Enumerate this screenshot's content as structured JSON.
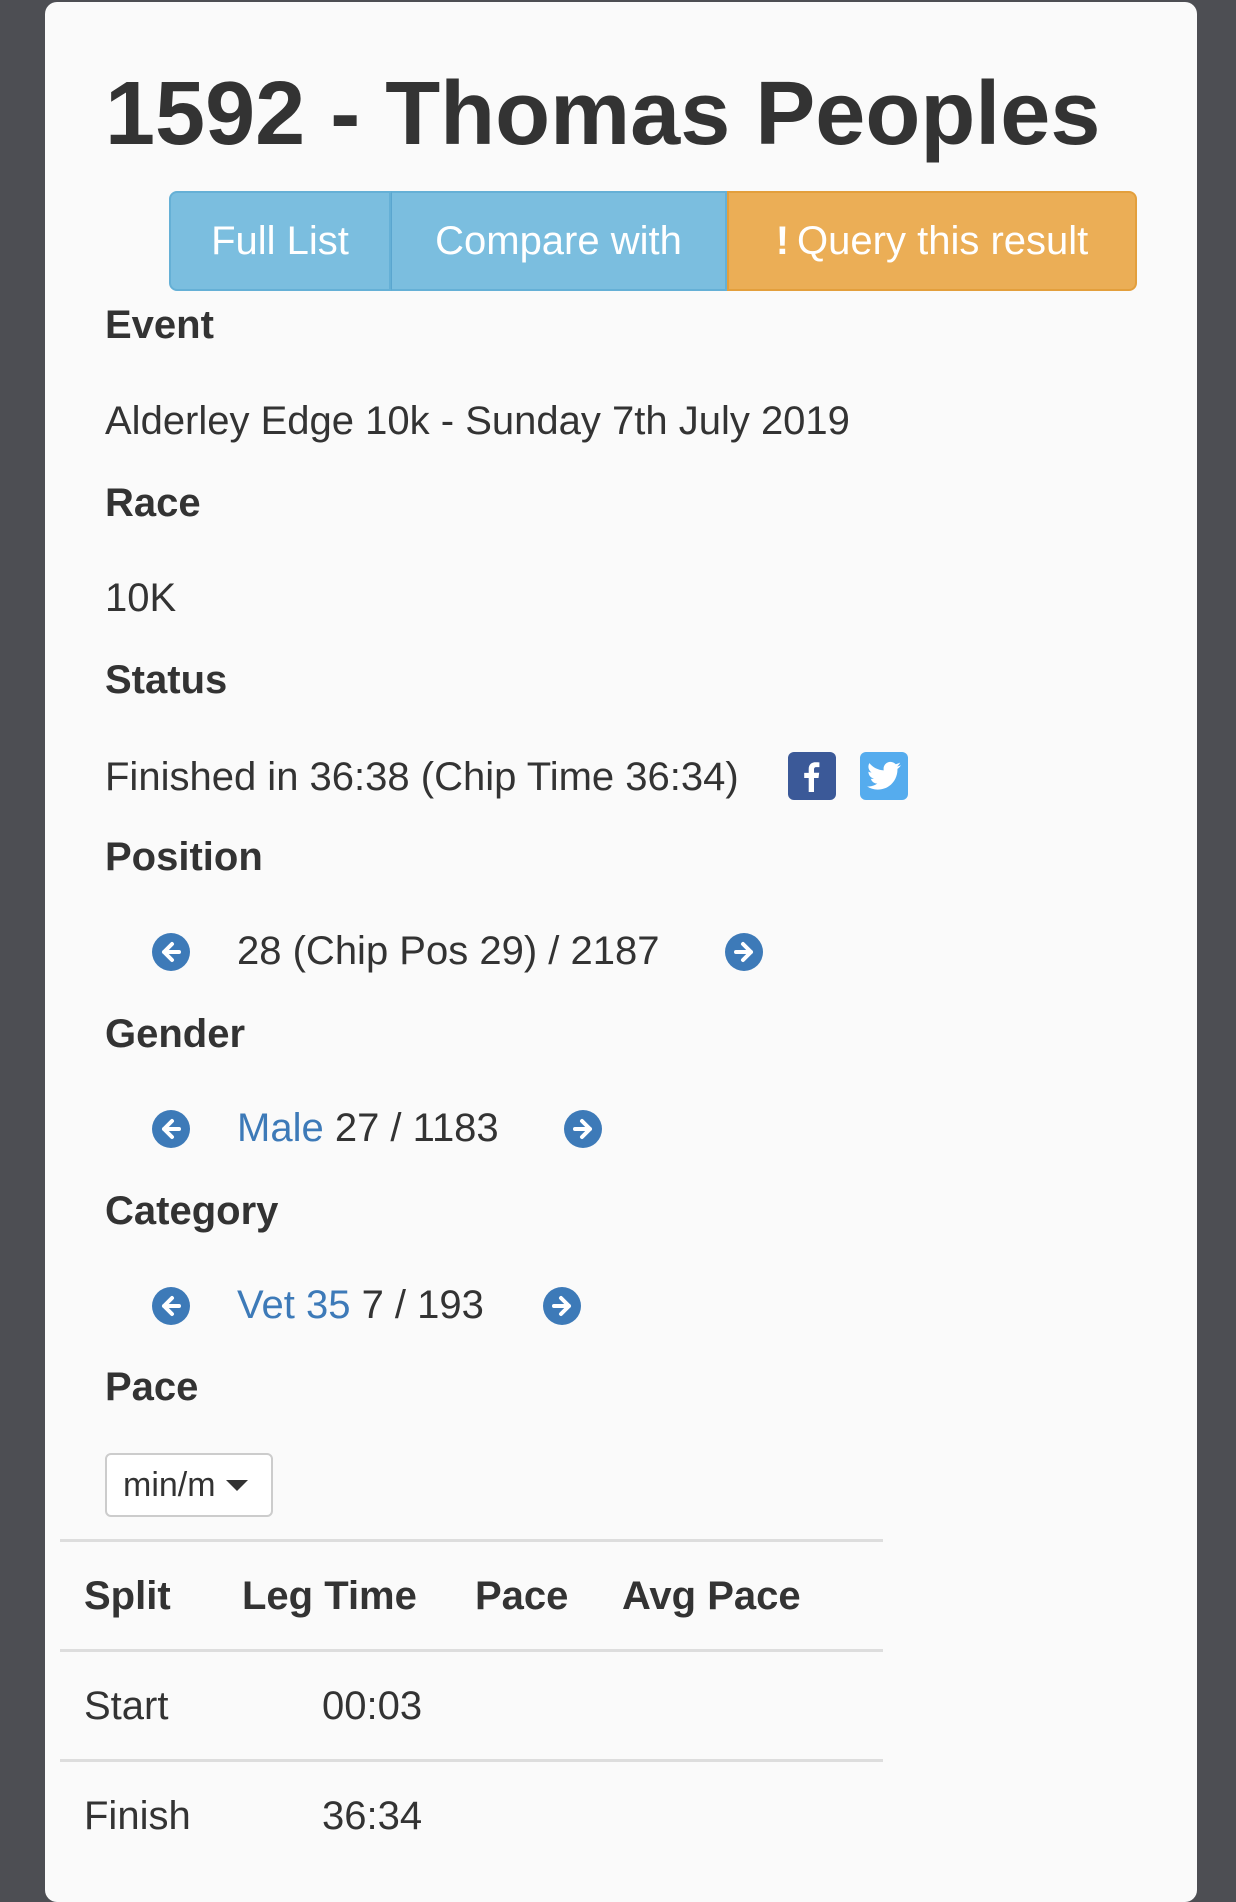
{
  "header": {
    "title": "1592 - Thomas Peoples",
    "buttons": {
      "full_list": "Full List",
      "compare": "Compare with",
      "query_mark": "!",
      "query": "Query this result"
    }
  },
  "event": {
    "label": "Event",
    "value": "Alderley Edge 10k - Sunday 7th July 2019"
  },
  "race": {
    "label": "Race",
    "value": "10K"
  },
  "status": {
    "label": "Status",
    "value": "Finished in 36:38 (Chip Time 36:34)",
    "share_icons": [
      "facebook-icon",
      "twitter-icon"
    ],
    "facebook_color": "#3b5998",
    "twitter_color": "#55acee"
  },
  "position": {
    "label": "Position",
    "value": "28 (Chip Pos 29) / 2187"
  },
  "gender": {
    "label": "Gender",
    "link": "Male",
    "value": "27 / 1183"
  },
  "category": {
    "label": "Category",
    "link": "Vet 35",
    "value": "7 / 193"
  },
  "pace": {
    "label": "Pace",
    "unit_selected": "min/m"
  },
  "splits": {
    "headers": [
      "Split",
      "Leg Time",
      "Pace",
      "Avg Pace"
    ],
    "rows": [
      {
        "split": "Start",
        "leg_time": "00:03"
      },
      {
        "split": "Finish",
        "leg_time": "36:34"
      }
    ]
  },
  "colors": {
    "info_button": "#7bbedf",
    "warning_button": "#ebae56",
    "link": "#3d7ab8",
    "background": "#4d4e53"
  }
}
